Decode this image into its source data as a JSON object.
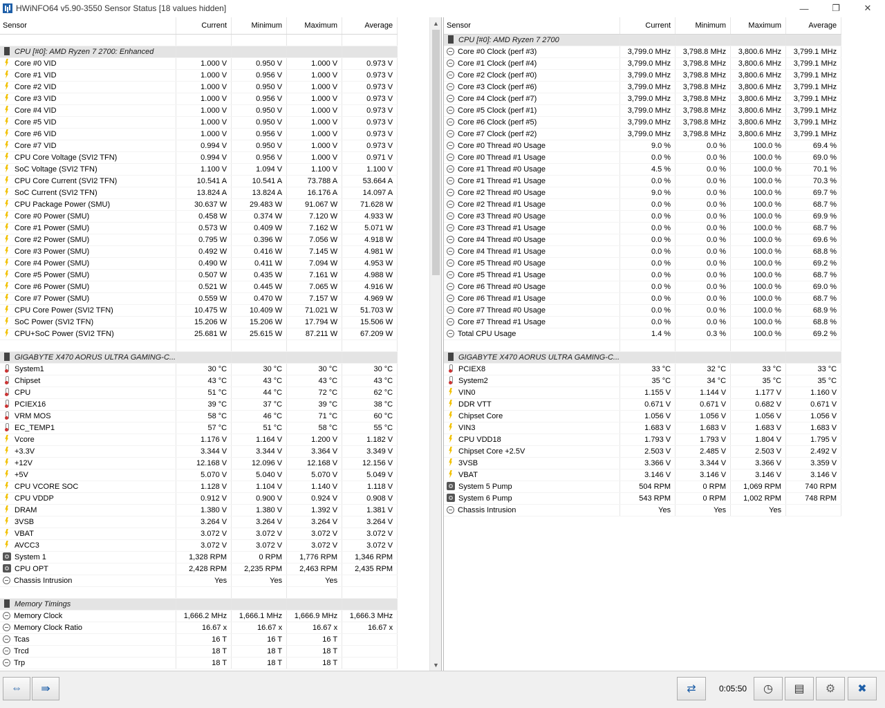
{
  "window": {
    "title": "HWiNFO64 v5.90-3550 Sensor Status [18 values hidden]",
    "minimize_glyph": "—",
    "restore_glyph": "❐",
    "close_glyph": "✕"
  },
  "columns": {
    "sensor": "Sensor",
    "current": "Current",
    "minimum": "Minimum",
    "maximum": "Maximum",
    "average": "Average"
  },
  "left_rows": [
    {
      "type": "spacer"
    },
    {
      "type": "group",
      "label": "CPU [#0]: AMD Ryzen 7 2700: Enhanced"
    },
    {
      "icon": "volt",
      "name": "Core #0 VID",
      "cur": "1.000 V",
      "min": "0.950 V",
      "max": "1.000 V",
      "avg": "0.973 V"
    },
    {
      "icon": "volt",
      "name": "Core #1 VID",
      "cur": "1.000 V",
      "min": "0.956 V",
      "max": "1.000 V",
      "avg": "0.973 V"
    },
    {
      "icon": "volt",
      "name": "Core #2 VID",
      "cur": "1.000 V",
      "min": "0.950 V",
      "max": "1.000 V",
      "avg": "0.973 V"
    },
    {
      "icon": "volt",
      "name": "Core #3 VID",
      "cur": "1.000 V",
      "min": "0.956 V",
      "max": "1.000 V",
      "avg": "0.973 V"
    },
    {
      "icon": "volt",
      "name": "Core #4 VID",
      "cur": "1.000 V",
      "min": "0.950 V",
      "max": "1.000 V",
      "avg": "0.973 V"
    },
    {
      "icon": "volt",
      "name": "Core #5 VID",
      "cur": "1.000 V",
      "min": "0.950 V",
      "max": "1.000 V",
      "avg": "0.973 V"
    },
    {
      "icon": "volt",
      "name": "Core #6 VID",
      "cur": "1.000 V",
      "min": "0.956 V",
      "max": "1.000 V",
      "avg": "0.973 V"
    },
    {
      "icon": "volt",
      "name": "Core #7 VID",
      "cur": "0.994 V",
      "min": "0.950 V",
      "max": "1.000 V",
      "avg": "0.973 V"
    },
    {
      "icon": "volt",
      "name": "CPU Core Voltage (SVI2 TFN)",
      "cur": "0.994 V",
      "min": "0.956 V",
      "max": "1.000 V",
      "avg": "0.971 V"
    },
    {
      "icon": "volt",
      "name": "SoC Voltage (SVI2 TFN)",
      "cur": "1.100 V",
      "min": "1.094 V",
      "max": "1.100 V",
      "avg": "1.100 V"
    },
    {
      "icon": "volt",
      "name": "CPU Core Current (SVI2 TFN)",
      "cur": "10.541 A",
      "min": "10.541 A",
      "max": "73.788 A",
      "avg": "53.664 A"
    },
    {
      "icon": "volt",
      "name": "SoC Current (SVI2 TFN)",
      "cur": "13.824 A",
      "min": "13.824 A",
      "max": "16.176 A",
      "avg": "14.097 A"
    },
    {
      "icon": "volt",
      "name": "CPU Package Power (SMU)",
      "cur": "30.637 W",
      "min": "29.483 W",
      "max": "91.067 W",
      "avg": "71.628 W"
    },
    {
      "icon": "volt",
      "name": "Core #0 Power (SMU)",
      "cur": "0.458 W",
      "min": "0.374 W",
      "max": "7.120 W",
      "avg": "4.933 W"
    },
    {
      "icon": "volt",
      "name": "Core #1 Power (SMU)",
      "cur": "0.573 W",
      "min": "0.409 W",
      "max": "7.162 W",
      "avg": "5.071 W"
    },
    {
      "icon": "volt",
      "name": "Core #2 Power (SMU)",
      "cur": "0.795 W",
      "min": "0.396 W",
      "max": "7.056 W",
      "avg": "4.918 W"
    },
    {
      "icon": "volt",
      "name": "Core #3 Power (SMU)",
      "cur": "0.492 W",
      "min": "0.416 W",
      "max": "7.145 W",
      "avg": "4.981 W"
    },
    {
      "icon": "volt",
      "name": "Core #4 Power (SMU)",
      "cur": "0.490 W",
      "min": "0.411 W",
      "max": "7.094 W",
      "avg": "4.953 W"
    },
    {
      "icon": "volt",
      "name": "Core #5 Power (SMU)",
      "cur": "0.507 W",
      "min": "0.435 W",
      "max": "7.161 W",
      "avg": "4.988 W"
    },
    {
      "icon": "volt",
      "name": "Core #6 Power (SMU)",
      "cur": "0.521 W",
      "min": "0.445 W",
      "max": "7.065 W",
      "avg": "4.916 W"
    },
    {
      "icon": "volt",
      "name": "Core #7 Power (SMU)",
      "cur": "0.559 W",
      "min": "0.470 W",
      "max": "7.157 W",
      "avg": "4.969 W"
    },
    {
      "icon": "volt",
      "name": "CPU Core Power (SVI2 TFN)",
      "cur": "10.475 W",
      "min": "10.409 W",
      "max": "71.021 W",
      "avg": "51.703 W"
    },
    {
      "icon": "volt",
      "name": "SoC Power (SVI2 TFN)",
      "cur": "15.206 W",
      "min": "15.206 W",
      "max": "17.794 W",
      "avg": "15.506 W"
    },
    {
      "icon": "volt",
      "name": "CPU+SoC Power (SVI2 TFN)",
      "cur": "25.681 W",
      "min": "25.615 W",
      "max": "87.211 W",
      "avg": "67.209 W"
    },
    {
      "type": "spacer"
    },
    {
      "type": "group",
      "label": "GIGABYTE X470 AORUS ULTRA GAMING-C..."
    },
    {
      "icon": "therm",
      "name": "System1",
      "cur": "30 °C",
      "min": "30 °C",
      "max": "30 °C",
      "avg": "30 °C"
    },
    {
      "icon": "therm",
      "name": "Chipset",
      "cur": "43 °C",
      "min": "43 °C",
      "max": "43 °C",
      "avg": "43 °C"
    },
    {
      "icon": "therm",
      "name": "CPU",
      "cur": "51 °C",
      "min": "44 °C",
      "max": "72 °C",
      "avg": "62 °C"
    },
    {
      "icon": "therm",
      "name": "PCIEX16",
      "cur": "39 °C",
      "min": "37 °C",
      "max": "39 °C",
      "avg": "38 °C"
    },
    {
      "icon": "therm",
      "name": "VRM MOS",
      "cur": "58 °C",
      "min": "46 °C",
      "max": "71 °C",
      "avg": "60 °C"
    },
    {
      "icon": "therm",
      "name": "EC_TEMP1",
      "cur": "57 °C",
      "min": "51 °C",
      "max": "58 °C",
      "avg": "55 °C"
    },
    {
      "icon": "volt",
      "name": "Vcore",
      "cur": "1.176 V",
      "min": "1.164 V",
      "max": "1.200 V",
      "avg": "1.182 V"
    },
    {
      "icon": "volt",
      "name": "+3.3V",
      "cur": "3.344 V",
      "min": "3.344 V",
      "max": "3.364 V",
      "avg": "3.349 V"
    },
    {
      "icon": "volt",
      "name": "+12V",
      "cur": "12.168 V",
      "min": "12.096 V",
      "max": "12.168 V",
      "avg": "12.156 V"
    },
    {
      "icon": "volt",
      "name": "+5V",
      "cur": "5.070 V",
      "min": "5.040 V",
      "max": "5.070 V",
      "avg": "5.049 V"
    },
    {
      "icon": "volt",
      "name": "CPU VCORE SOC",
      "cur": "1.128 V",
      "min": "1.104 V",
      "max": "1.140 V",
      "avg": "1.118 V"
    },
    {
      "icon": "volt",
      "name": "CPU VDDP",
      "cur": "0.912 V",
      "min": "0.900 V",
      "max": "0.924 V",
      "avg": "0.908 V"
    },
    {
      "icon": "volt",
      "name": "DRAM",
      "cur": "1.380 V",
      "min": "1.380 V",
      "max": "1.392 V",
      "avg": "1.381 V"
    },
    {
      "icon": "volt",
      "name": "3VSB",
      "cur": "3.264 V",
      "min": "3.264 V",
      "max": "3.264 V",
      "avg": "3.264 V"
    },
    {
      "icon": "volt",
      "name": "VBAT",
      "cur": "3.072 V",
      "min": "3.072 V",
      "max": "3.072 V",
      "avg": "3.072 V"
    },
    {
      "icon": "volt",
      "name": "AVCC3",
      "cur": "3.072 V",
      "min": "3.072 V",
      "max": "3.072 V",
      "avg": "3.072 V"
    },
    {
      "icon": "fan",
      "name": "System 1",
      "cur": "1,328 RPM",
      "min": "0 RPM",
      "max": "1,776 RPM",
      "avg": "1,346 RPM"
    },
    {
      "icon": "fan",
      "name": "CPU OPT",
      "cur": "2,428 RPM",
      "min": "2,235 RPM",
      "max": "2,463 RPM",
      "avg": "2,435 RPM"
    },
    {
      "icon": "clock",
      "name": "Chassis Intrusion",
      "cur": "Yes",
      "min": "Yes",
      "max": "Yes",
      "avg": ""
    },
    {
      "type": "spacer"
    },
    {
      "type": "group",
      "label": "Memory Timings"
    },
    {
      "icon": "clock",
      "name": "Memory Clock",
      "cur": "1,666.2 MHz",
      "min": "1,666.1 MHz",
      "max": "1,666.9 MHz",
      "avg": "1,666.3 MHz"
    },
    {
      "icon": "clock",
      "name": "Memory Clock Ratio",
      "cur": "16.67 x",
      "min": "16.67 x",
      "max": "16.67 x",
      "avg": "16.67 x"
    },
    {
      "icon": "clock",
      "name": "Tcas",
      "cur": "16 T",
      "min": "16 T",
      "max": "16 T",
      "avg": ""
    },
    {
      "icon": "clock",
      "name": "Trcd",
      "cur": "18 T",
      "min": "18 T",
      "max": "18 T",
      "avg": ""
    },
    {
      "icon": "clock",
      "name": "Trp",
      "cur": "18 T",
      "min": "18 T",
      "max": "18 T",
      "avg": ""
    }
  ],
  "right_rows": [
    {
      "type": "group",
      "label": "CPU [#0]: AMD Ryzen 7 2700"
    },
    {
      "icon": "clock",
      "name": "Core #0 Clock (perf #3)",
      "cur": "3,799.0 MHz",
      "min": "3,798.8 MHz",
      "max": "3,800.6 MHz",
      "avg": "3,799.1 MHz"
    },
    {
      "icon": "clock",
      "name": "Core #1 Clock (perf #4)",
      "cur": "3,799.0 MHz",
      "min": "3,798.8 MHz",
      "max": "3,800.6 MHz",
      "avg": "3,799.1 MHz"
    },
    {
      "icon": "clock",
      "name": "Core #2 Clock (perf #0)",
      "cur": "3,799.0 MHz",
      "min": "3,798.8 MHz",
      "max": "3,800.6 MHz",
      "avg": "3,799.1 MHz"
    },
    {
      "icon": "clock",
      "name": "Core #3 Clock (perf #6)",
      "cur": "3,799.0 MHz",
      "min": "3,798.8 MHz",
      "max": "3,800.6 MHz",
      "avg": "3,799.1 MHz"
    },
    {
      "icon": "clock",
      "name": "Core #4 Clock (perf #7)",
      "cur": "3,799.0 MHz",
      "min": "3,798.8 MHz",
      "max": "3,800.6 MHz",
      "avg": "3,799.1 MHz"
    },
    {
      "icon": "clock",
      "name": "Core #5 Clock (perf #1)",
      "cur": "3,799.0 MHz",
      "min": "3,798.8 MHz",
      "max": "3,800.6 MHz",
      "avg": "3,799.1 MHz"
    },
    {
      "icon": "clock",
      "name": "Core #6 Clock (perf #5)",
      "cur": "3,799.0 MHz",
      "min": "3,798.8 MHz",
      "max": "3,800.6 MHz",
      "avg": "3,799.1 MHz"
    },
    {
      "icon": "clock",
      "name": "Core #7 Clock (perf #2)",
      "cur": "3,799.0 MHz",
      "min": "3,798.8 MHz",
      "max": "3,800.6 MHz",
      "avg": "3,799.1 MHz"
    },
    {
      "icon": "clock",
      "name": "Core #0 Thread #0 Usage",
      "cur": "9.0 %",
      "min": "0.0 %",
      "max": "100.0 %",
      "avg": "69.4 %"
    },
    {
      "icon": "clock",
      "name": "Core #0 Thread #1 Usage",
      "cur": "0.0 %",
      "min": "0.0 %",
      "max": "100.0 %",
      "avg": "69.0 %"
    },
    {
      "icon": "clock",
      "name": "Core #1 Thread #0 Usage",
      "cur": "4.5 %",
      "min": "0.0 %",
      "max": "100.0 %",
      "avg": "70.1 %"
    },
    {
      "icon": "clock",
      "name": "Core #1 Thread #1 Usage",
      "cur": "0.0 %",
      "min": "0.0 %",
      "max": "100.0 %",
      "avg": "70.3 %"
    },
    {
      "icon": "clock",
      "name": "Core #2 Thread #0 Usage",
      "cur": "9.0 %",
      "min": "0.0 %",
      "max": "100.0 %",
      "avg": "69.7 %"
    },
    {
      "icon": "clock",
      "name": "Core #2 Thread #1 Usage",
      "cur": "0.0 %",
      "min": "0.0 %",
      "max": "100.0 %",
      "avg": "68.7 %"
    },
    {
      "icon": "clock",
      "name": "Core #3 Thread #0 Usage",
      "cur": "0.0 %",
      "min": "0.0 %",
      "max": "100.0 %",
      "avg": "69.9 %"
    },
    {
      "icon": "clock",
      "name": "Core #3 Thread #1 Usage",
      "cur": "0.0 %",
      "min": "0.0 %",
      "max": "100.0 %",
      "avg": "68.7 %"
    },
    {
      "icon": "clock",
      "name": "Core #4 Thread #0 Usage",
      "cur": "0.0 %",
      "min": "0.0 %",
      "max": "100.0 %",
      "avg": "69.6 %"
    },
    {
      "icon": "clock",
      "name": "Core #4 Thread #1 Usage",
      "cur": "0.0 %",
      "min": "0.0 %",
      "max": "100.0 %",
      "avg": "68.8 %"
    },
    {
      "icon": "clock",
      "name": "Core #5 Thread #0 Usage",
      "cur": "0.0 %",
      "min": "0.0 %",
      "max": "100.0 %",
      "avg": "69.2 %"
    },
    {
      "icon": "clock",
      "name": "Core #5 Thread #1 Usage",
      "cur": "0.0 %",
      "min": "0.0 %",
      "max": "100.0 %",
      "avg": "68.7 %"
    },
    {
      "icon": "clock",
      "name": "Core #6 Thread #0 Usage",
      "cur": "0.0 %",
      "min": "0.0 %",
      "max": "100.0 %",
      "avg": "69.0 %"
    },
    {
      "icon": "clock",
      "name": "Core #6 Thread #1 Usage",
      "cur": "0.0 %",
      "min": "0.0 %",
      "max": "100.0 %",
      "avg": "68.7 %"
    },
    {
      "icon": "clock",
      "name": "Core #7 Thread #0 Usage",
      "cur": "0.0 %",
      "min": "0.0 %",
      "max": "100.0 %",
      "avg": "68.9 %"
    },
    {
      "icon": "clock",
      "name": "Core #7 Thread #1 Usage",
      "cur": "0.0 %",
      "min": "0.0 %",
      "max": "100.0 %",
      "avg": "68.8 %"
    },
    {
      "icon": "clock",
      "name": "Total CPU Usage",
      "cur": "1.4 %",
      "min": "0.3 %",
      "max": "100.0 %",
      "avg": "69.2 %"
    },
    {
      "type": "spacer"
    },
    {
      "type": "group",
      "label": "GIGABYTE X470 AORUS ULTRA GAMING-C..."
    },
    {
      "icon": "therm",
      "name": "PCIEX8",
      "cur": "33 °C",
      "min": "32 °C",
      "max": "33 °C",
      "avg": "33 °C"
    },
    {
      "icon": "therm",
      "name": "System2",
      "cur": "35 °C",
      "min": "34 °C",
      "max": "35 °C",
      "avg": "35 °C"
    },
    {
      "icon": "volt",
      "name": "VIN0",
      "cur": "1.155 V",
      "min": "1.144 V",
      "max": "1.177 V",
      "avg": "1.160 V"
    },
    {
      "icon": "volt",
      "name": "DDR VTT",
      "cur": "0.671 V",
      "min": "0.671 V",
      "max": "0.682 V",
      "avg": "0.671 V"
    },
    {
      "icon": "volt",
      "name": "Chipset Core",
      "cur": "1.056 V",
      "min": "1.056 V",
      "max": "1.056 V",
      "avg": "1.056 V"
    },
    {
      "icon": "volt",
      "name": "VIN3",
      "cur": "1.683 V",
      "min": "1.683 V",
      "max": "1.683 V",
      "avg": "1.683 V"
    },
    {
      "icon": "volt",
      "name": "CPU VDD18",
      "cur": "1.793 V",
      "min": "1.793 V",
      "max": "1.804 V",
      "avg": "1.795 V"
    },
    {
      "icon": "volt",
      "name": "Chipset Core +2.5V",
      "cur": "2.503 V",
      "min": "2.485 V",
      "max": "2.503 V",
      "avg": "2.492 V"
    },
    {
      "icon": "volt",
      "name": "3VSB",
      "cur": "3.366 V",
      "min": "3.344 V",
      "max": "3.366 V",
      "avg": "3.359 V"
    },
    {
      "icon": "volt",
      "name": "VBAT",
      "cur": "3.146 V",
      "min": "3.146 V",
      "max": "3.146 V",
      "avg": "3.146 V"
    },
    {
      "icon": "fan",
      "name": "System 5 Pump",
      "cur": "504 RPM",
      "min": "0 RPM",
      "max": "1,069 RPM",
      "avg": "740 RPM"
    },
    {
      "icon": "fan",
      "name": "System 6 Pump",
      "cur": "543 RPM",
      "min": "0 RPM",
      "max": "1,002 RPM",
      "avg": "748 RPM"
    },
    {
      "icon": "clock",
      "name": "Chassis Intrusion",
      "cur": "Yes",
      "min": "Yes",
      "max": "Yes",
      "avg": ""
    }
  ],
  "statusbar": {
    "timer": "0:05:50",
    "nav_left_glyph": "⇔",
    "nav_right_glyph": "⇛",
    "network_glyph": "⇄",
    "clock_glyph": "◷",
    "report_glyph": "▤",
    "settings_glyph": "⚙",
    "close_glyph": "✖"
  },
  "scrollbar": {
    "up_glyph": "▲",
    "down_glyph": "▼"
  },
  "colors": {
    "group_bg": "#e4e4e4",
    "volt_icon": "#f2c100",
    "accent": "#1e5fa8"
  }
}
